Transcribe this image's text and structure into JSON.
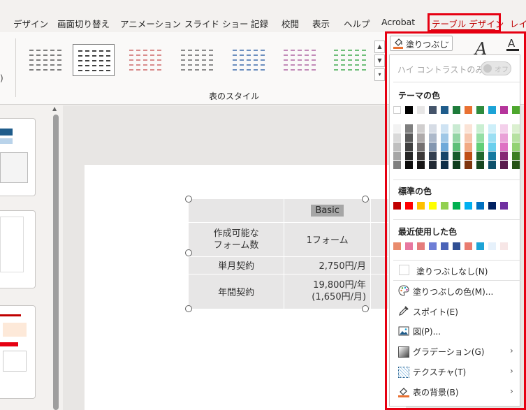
{
  "tabs": [
    "デザイン",
    "画面切り替え",
    "アニメーション",
    "スライド ショー",
    "記録",
    "校閲",
    "表示",
    "ヘルプ",
    "Acrobat",
    "テーブル デザイン",
    "レイ"
  ],
  "ribbon": {
    "left_edge_text": ")",
    "styles_group_label": "表のスタイル",
    "fill_button_label": "塗りつぶし",
    "fill_button_chevron": "⌄",
    "text_effect_icon": "A",
    "font_color_icon": "A"
  },
  "table": {
    "rows": [
      [
        "",
        "Basic",
        ""
      ],
      [
        "作成可能な\nフォーム数",
        "1フォーム",
        ""
      ],
      [
        "単月契約",
        "2,750円/月",
        ""
      ],
      [
        "年間契約",
        "19,800円/年\n(1,650円/月)",
        ""
      ]
    ]
  },
  "dropdown": {
    "high_contrast_label": "ハイ コントラストのみ(H)",
    "high_contrast_toggle": "オフ",
    "theme_colors_heading": "テーマの色",
    "standard_colors_heading": "標準の色",
    "recent_colors_heading": "最近使用した色",
    "theme_colors": [
      "#ffffff",
      "#000000",
      "#e7e6e6",
      "#44546a",
      "#1f5c8b",
      "#1e7b3a",
      "#e97132",
      "#2e8b3d",
      "#1ca3d6",
      "#b5359b",
      "#4ea72e"
    ],
    "theme_shades": [
      [
        "#f2f2f2",
        "#d9d9d9",
        "#bfbfbf",
        "#a6a6a6",
        "#808080"
      ],
      [
        "#7f7f7f",
        "#595959",
        "#404040",
        "#262626",
        "#0d0d0d"
      ],
      [
        "#d0cece",
        "#aeaaaa",
        "#757171",
        "#3b3838",
        "#171616"
      ],
      [
        "#d6dce5",
        "#adb9ca",
        "#8497b0",
        "#333f50",
        "#222a35"
      ],
      [
        "#cfe3f3",
        "#9fc7e6",
        "#6ea9d9",
        "#174569",
        "#0f2e46"
      ],
      [
        "#c9ead2",
        "#93d5a5",
        "#5dbf78",
        "#165c2b",
        "#0e3d1d"
      ],
      [
        "#fbe3d6",
        "#f6c6ad",
        "#f1a983",
        "#c04f15",
        "#7f350e"
      ],
      [
        "#caefd2",
        "#95dfa5",
        "#61cf78",
        "#22682e",
        "#17451f"
      ],
      [
        "#cdeff9",
        "#9bdff3",
        "#69cfed",
        "#157aa0",
        "#0e516b"
      ],
      [
        "#f4d0eb",
        "#e9a1d7",
        "#de72c3",
        "#872874",
        "#5a1b4d"
      ],
      [
        "#dbf0d0",
        "#b6e1a1",
        "#92d272",
        "#3b7d22",
        "#275317"
      ]
    ],
    "standard_colors": [
      "#c00000",
      "#ff0000",
      "#ffc000",
      "#ffff00",
      "#92d050",
      "#00b050",
      "#00b0f0",
      "#0070c0",
      "#002060",
      "#7030a0"
    ],
    "recent_colors": [
      "#e98b6c",
      "#e878a0",
      "#e57c7c",
      "#6e7ed6",
      "#4a63b8",
      "#2f4e93",
      "#e97c70",
      "#1ca3d6",
      "#e6f1fb",
      "#f7e6e6"
    ],
    "menu_items": [
      {
        "label": "塗りつぶしなし(N)",
        "icon": "no-fill-icon"
      },
      {
        "label": "塗りつぶしの色(M)...",
        "icon": "palette-icon"
      },
      {
        "label": "スポイト(E)",
        "icon": "eyedropper-icon"
      },
      {
        "label": "図(P)...",
        "icon": "picture-icon"
      },
      {
        "label": "グラデーション(G)",
        "icon": "gradient-icon",
        "arrow": "›"
      },
      {
        "label": "テクスチャ(T)",
        "icon": "texture-icon",
        "arrow": "›"
      },
      {
        "label": "表の背景(B)",
        "icon": "table-background-icon",
        "arrow": "›"
      }
    ]
  }
}
